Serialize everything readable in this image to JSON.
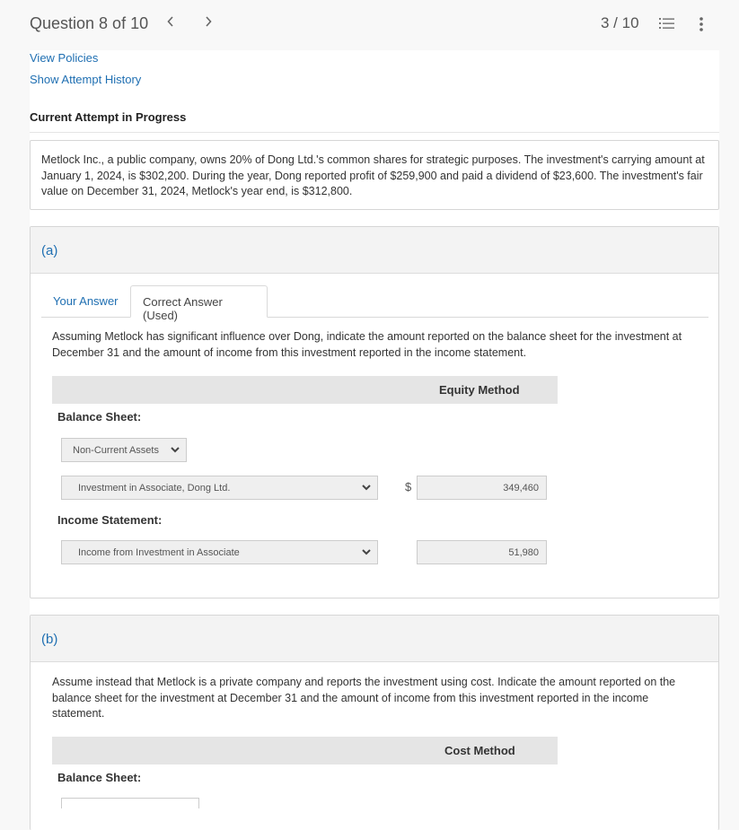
{
  "header": {
    "question_title": "Question 8 of 10",
    "prev_icon": "chevron-left",
    "next_icon": "chevron-right",
    "progress": "3 / 10",
    "list_icon": "numbered-list-icon",
    "more_icon": "vertical-ellipsis-icon"
  },
  "links": {
    "view_policies": "View Policies",
    "show_attempt_history": "Show Attempt History"
  },
  "attempt_status": "Current Attempt in Progress",
  "problem_text": "Metlock Inc., a public company, owns 20% of Dong Ltd.'s common shares for strategic purposes. The investment's carrying amount at January 1, 2024, is $302,200. During the year, Dong reported profit of $259,900 and paid a dividend of $23,600. The investment's fair value on December 31, 2024, Metlock's year end, is $312,800.",
  "part_a": {
    "label": "(a)",
    "tabs": [
      {
        "label": "Your Answer",
        "active": false
      },
      {
        "label": "Correct Answer (Used)",
        "active": true
      }
    ],
    "instruction": "Assuming Metlock has significant influence over Dong, indicate the amount reported on the balance sheet for the investment at December 31 and the amount of income from this investment reported in the income statement.",
    "column_header": "Equity Method",
    "balance_sheet_label": "Balance Sheet:",
    "balance_category_select": "Non-Current Assets",
    "balance_account_select": "Investment in Associate, Dong Ltd.",
    "currency_symbol": "$",
    "balance_amount": "349,460",
    "income_statement_label": "Income Statement:",
    "income_account_select": "Income from Investment in Associate",
    "income_amount": "51,980"
  },
  "part_b": {
    "label": "(b)",
    "instruction": "Assume instead that Metlock is a private company and reports the investment using cost. Indicate the amount reported on the balance sheet for the investment at December 31 and the amount of income from this investment reported in the income statement.",
    "column_header": "Cost Method",
    "balance_sheet_label": "Balance Sheet:"
  },
  "colors": {
    "link": "#1f6fb2",
    "header_bg": "#f3f3f3",
    "column_header_bg": "#e5e5e5",
    "input_bg": "#efefef"
  }
}
